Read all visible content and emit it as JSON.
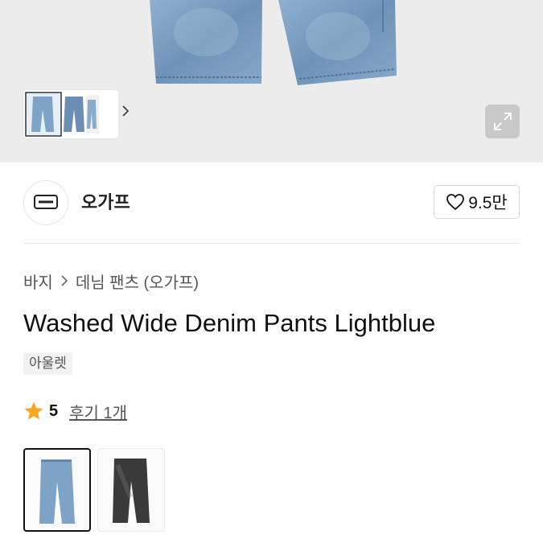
{
  "hero": {
    "image_alt": "Light blue washed wide denim pants",
    "thumbnail_next_icon": "chevron-right-icon",
    "expand_icon": "expand-arrows-icon"
  },
  "brand": {
    "name": "오가프",
    "logo_icon": "brand-logo",
    "like_icon": "heart-outline-icon",
    "like_count": "9.5만"
  },
  "breadcrumb": {
    "items": [
      "바지",
      "데님 팬츠 (오가프)"
    ],
    "separator_icon": "chevron-right-icon"
  },
  "product": {
    "title": "Washed Wide Denim Pants Lightblue",
    "tag": "아울렛"
  },
  "rating": {
    "star_icon": "star-icon",
    "score": "5",
    "review_link": "후기 1개"
  },
  "colors": {
    "star": "#F5A623",
    "denim_light": "#7fa3c6",
    "denim_dark": "#3a3a3a",
    "selected_border": "#111111"
  },
  "variants": [
    {
      "name": "light-blue",
      "selected": true
    },
    {
      "name": "washed-black",
      "selected": false
    }
  ]
}
